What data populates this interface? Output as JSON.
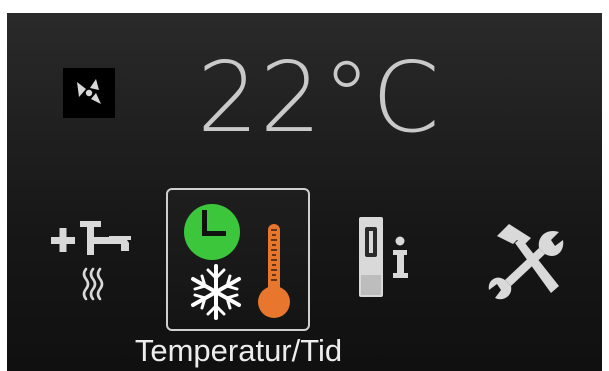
{
  "display": {
    "temperature": "22°C",
    "selected_label": "Temperatur/Tid"
  },
  "icons": {
    "fan": "fan-icon",
    "faucet": "hot-water-faucet-icon",
    "clock": "clock-icon",
    "snowflake": "snowflake-icon",
    "thermometer": "thermometer-icon",
    "info": "device-info-icon",
    "tools": "tools-icon"
  },
  "colors": {
    "clock_green": "#3cc63c",
    "thermometer_orange": "#e8762c",
    "temperature_text": "#c9c9c9"
  }
}
